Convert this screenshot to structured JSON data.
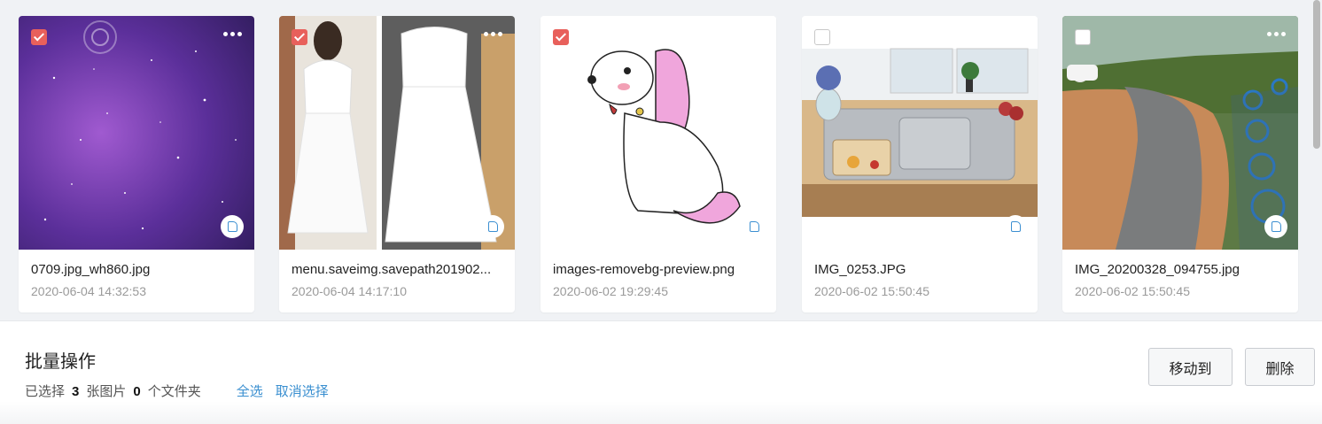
{
  "files": [
    {
      "name": "0709.jpg_wh860.jpg",
      "date": "2020-06-04 14:32:53",
      "selected": true,
      "thumb": "purple-starry-sky"
    },
    {
      "name": "menu.saveimg.savepath201902...",
      "date": "2020-06-04 14:17:10",
      "selected": true,
      "thumb": "white-lace-dress"
    },
    {
      "name": "images-removebg-preview.png",
      "date": "2020-06-02 19:29:45",
      "selected": true,
      "thumb": "pink-cartoon-dog"
    },
    {
      "name": "IMG_0253.JPG",
      "date": "2020-06-02 15:50:45",
      "selected": false,
      "thumb": "kitchen-sink"
    },
    {
      "name": "IMG_20200328_094755.jpg",
      "date": "2020-06-02 15:50:45",
      "selected": false,
      "thumb": "road-with-bicycles"
    }
  ],
  "batch": {
    "title": "批量操作",
    "selected_prefix": "已选择",
    "image_count": "3",
    "image_unit": "张图片",
    "folder_count": "0",
    "folder_unit": "个文件夹",
    "select_all": "全选",
    "deselect": "取消选择",
    "move_to": "移动到",
    "delete": "删除"
  },
  "colors": {
    "accent_check": "#e8605b",
    "link": "#3a8fd0"
  }
}
